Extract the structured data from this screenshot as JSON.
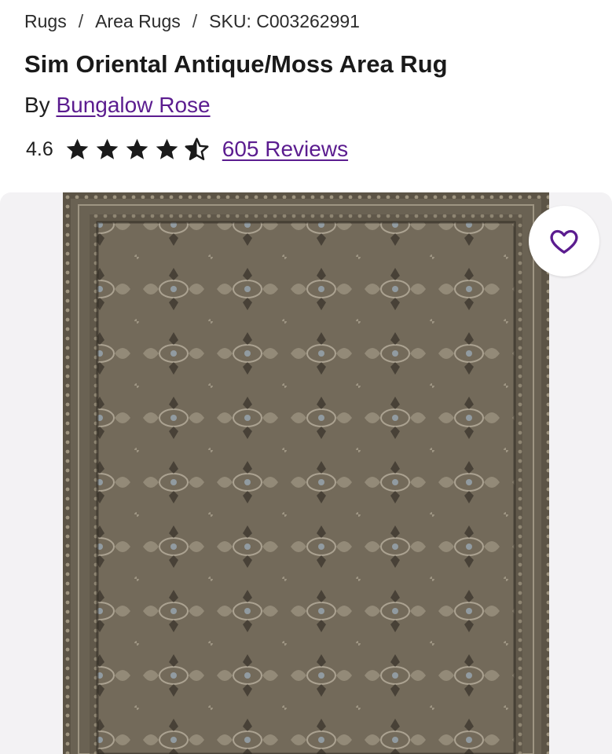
{
  "breadcrumb": {
    "items": [
      "Rugs",
      "Area Rugs"
    ],
    "separator": "/",
    "sku": "SKU: C003262991"
  },
  "product": {
    "title": "Sim Oriental Antique/Moss Area Rug",
    "by_prefix": "By",
    "brand": "Bungalow Rose",
    "rating": "4.6",
    "stars": {
      "full": 4,
      "half": 1,
      "max": 5
    },
    "reviews_label": "605 Reviews"
  },
  "gallery": {
    "favorite_icon": "heart-outline-icon",
    "image": "rug-image"
  },
  "colors": {
    "link": "#5b1c8f",
    "text": "#1f1f1f",
    "gallery_bg": "#f3f2f4",
    "rug_base": "#6f6656"
  }
}
